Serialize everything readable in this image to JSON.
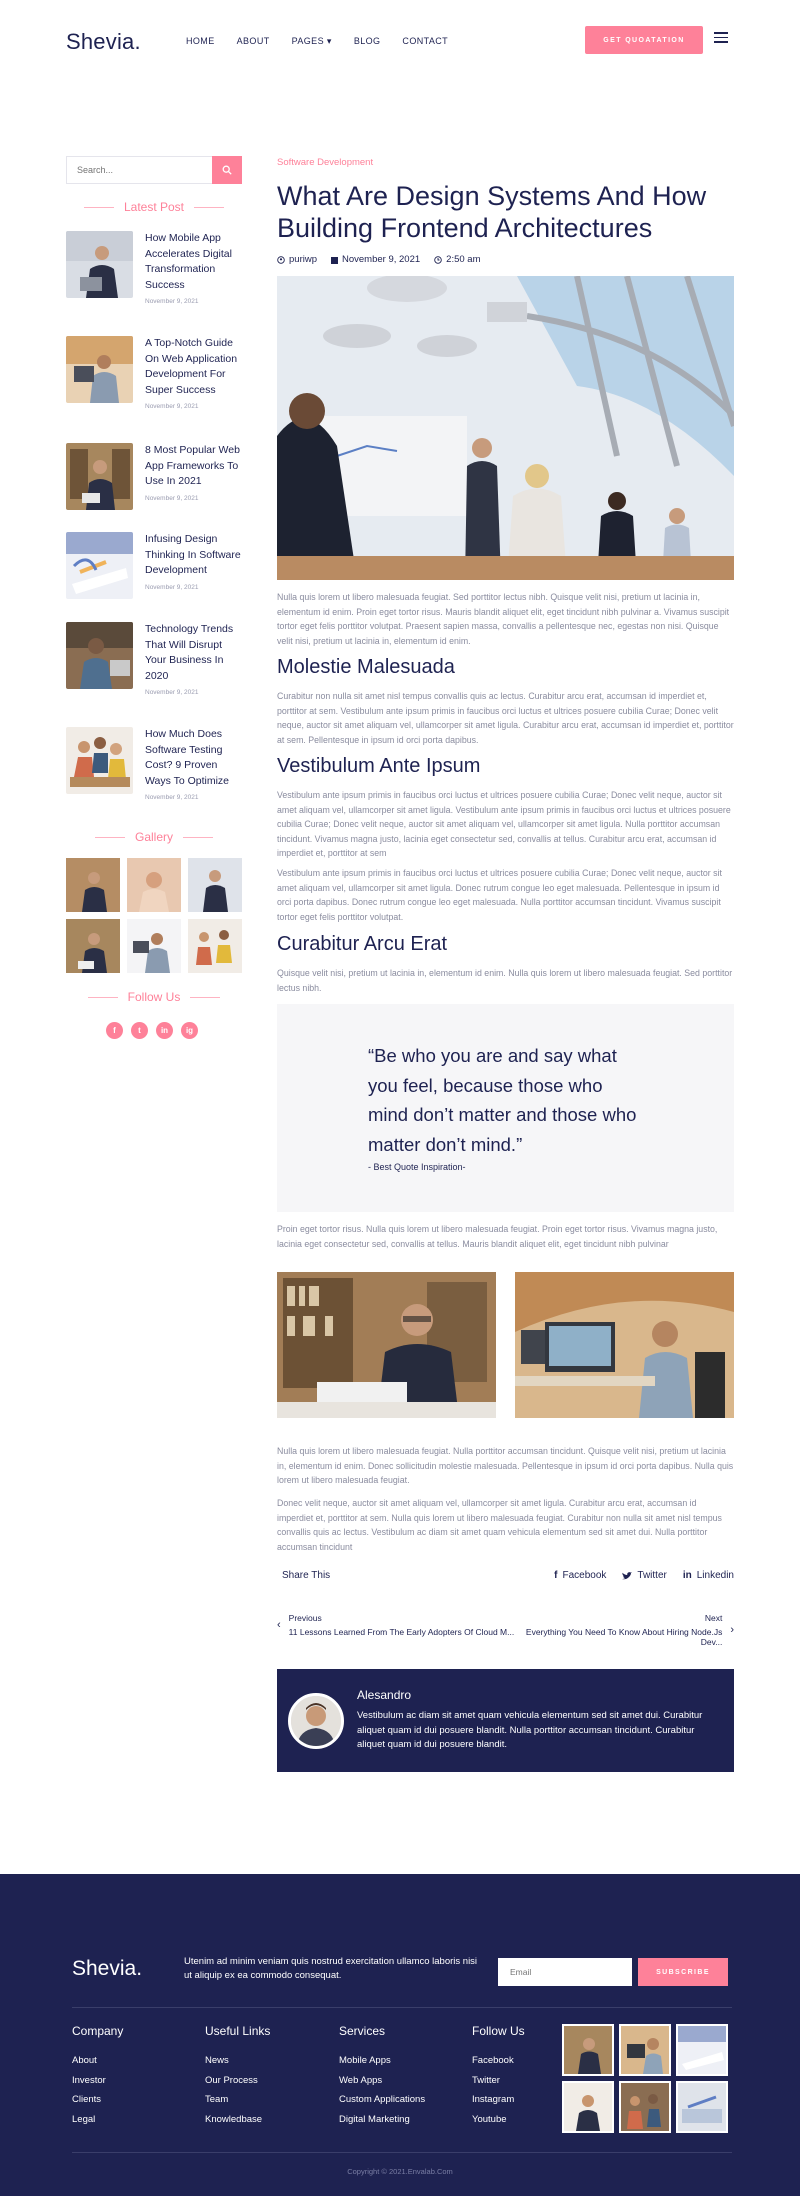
{
  "header": {
    "logo": "Shevia.",
    "nav": [
      "HOME",
      "ABOUT",
      "PAGES",
      "BLOG",
      "CONTACT"
    ],
    "quote_button": "GET QUOATATION"
  },
  "sidebar": {
    "search_placeholder": "Search...",
    "latest_title": "Latest Post",
    "posts": [
      {
        "title": "How Mobile App Accelerates Digital Transformation Success",
        "date": "November 9, 2021"
      },
      {
        "title": "A Top-Notch Guide On Web Application Development For Super Success",
        "date": "November 9, 2021"
      },
      {
        "title": "8 Most Popular Web App Frameworks To Use In 2021",
        "date": "November 9, 2021"
      },
      {
        "title": "Infusing Design Thinking In Software Development",
        "date": "November 9, 2021"
      },
      {
        "title": "Technology Trends That Will Disrupt Your Business In 2020",
        "date": "November 9, 2021"
      },
      {
        "title": "How Much Does Software Testing Cost? 9 Proven Ways To Optimize",
        "date": "November 9, 2021"
      }
    ],
    "gallery_title": "Gallery",
    "follow_title": "Follow Us",
    "socials": [
      "f",
      "t",
      "in",
      "ig"
    ]
  },
  "article": {
    "category": "Software Development",
    "title": "What Are Design Systems And How Building Frontend Architectures",
    "author": "puriwp",
    "date": "November 9, 2021",
    "read_time": "2:50 am",
    "p1": "Nulla quis lorem ut libero malesuada feugiat. Sed porttitor lectus nibh. Quisque velit nisi, pretium ut lacinia in, elementum id enim. Proin eget tortor risus. Mauris blandit aliquet elit, eget tincidunt nibh pulvinar a. Vivamus suscipit tortor eget felis porttitor volutpat. Praesent sapien massa, convallis a pellentesque nec, egestas non nisi. Quisque velit nisi, pretium ut lacinia in, elementum id enim.",
    "h_molestie": "Molestie Malesuada",
    "p2": "Curabitur non nulla sit amet nisl tempus convallis quis ac lectus. Curabitur arcu erat, accumsan id imperdiet et, porttitor at sem. Vestibulum ante ipsum primis in faucibus orci luctus et ultrices posuere cubilia Curae; Donec velit neque, auctor sit amet aliquam vel, ullamcorper sit amet ligula. Curabitur arcu erat, accumsan id imperdiet et, porttitor at sem. Pellentesque in ipsum id orci porta dapibus.",
    "h_vestibulum": "Vestibulum Ante Ipsum",
    "p3": "Vestibulum ante ipsum primis in faucibus orci luctus et ultrices posuere cubilia Curae; Donec velit neque, auctor sit amet aliquam vel, ullamcorper sit amet ligula. Vestibulum ante ipsum primis in faucibus orci luctus et ultrices posuere cubilia Curae; Donec velit neque, auctor sit amet aliquam vel, ullamcorper sit amet ligula. Nulla porttitor accumsan tincidunt. Vivamus magna justo, lacinia eget consectetur sed, convallis at tellus. Curabitur arcu erat, accumsan id imperdiet et, porttitor at sem",
    "p4": "Vestibulum ante ipsum primis in faucibus orci luctus et ultrices posuere cubilia Curae; Donec velit neque, auctor sit amet aliquam vel, ullamcorper sit amet ligula. Donec rutrum congue leo eget malesuada. Pellentesque in ipsum id orci porta dapibus. Donec rutrum congue leo eget malesuada. Nulla porttitor accumsan tincidunt. Vivamus suscipit tortor eget felis porttitor volutpat.",
    "h_curabitur": "Curabitur Arcu Erat",
    "p5": "Quisque velit nisi, pretium ut lacinia in, elementum id enim. Nulla quis lorem ut libero malesuada feugiat. Sed porttitor lectus nibh.",
    "quote": "“Be who you are and say what you feel, because those who mind don’t matter and those who matter don’t mind.”",
    "quote_cite": "- Best Quote Inspiration-",
    "p6": "Proin eget tortor risus. Nulla quis lorem ut libero malesuada feugiat. Proin eget tortor risus. Vivamus magna justo, lacinia eget consectetur sed, convallis at tellus. Mauris blandit aliquet elit, eget tincidunt nibh pulvinar",
    "p7": "Nulla quis lorem ut libero malesuada feugiat. Nulla porttitor accumsan tincidunt. Quisque velit nisi, pretium ut lacinia in, elementum id enim. Donec sollicitudin molestie malesuada. Pellentesque in ipsum id orci porta dapibus. Nulla quis lorem ut libero malesuada feugiat.",
    "p8": "Donec velit neque, auctor sit amet aliquam vel, ullamcorper sit amet ligula. Curabitur arcu erat, accumsan id imperdiet et, porttitor at sem. Nulla quis lorem ut libero malesuada feugiat. Curabitur non nulla sit amet nisl tempus convallis quis ac lectus. Vestibulum ac diam sit amet quam vehicula elementum sed sit amet dui. Nulla porttitor accumsan tincidunt",
    "share_label": "Share This",
    "share": [
      "Facebook",
      "Twitter",
      "Linkedin"
    ],
    "prev_label": "Previous",
    "prev_title": "11 Lessons Learned From The Early Adopters Of Cloud M...",
    "next_label": "Next",
    "next_title": "Everything You Need To Know About Hiring Node.Js Dev...",
    "author_name": "Alesandro",
    "author_bio": "Vestibulum ac diam sit amet quam vehicula elementum sed sit amet dui. Curabitur aliquet quam id dui posuere blandit. Nulla porttitor accumsan tincidunt. Curabitur aliquet quam id dui posuere blandit."
  },
  "footer": {
    "logo": "Shevia.",
    "tagline": "Utenim ad minim veniam quis nostrud exercitation ullamco laboris nisi ut aliquip ex ea commodo consequat.",
    "email_placeholder": "Email",
    "subscribe": "SUBSCRIBE",
    "columns": [
      {
        "title": "Company",
        "items": [
          "About",
          "Investor",
          "Clients",
          "Legal"
        ]
      },
      {
        "title": "Useful Links",
        "items": [
          "News",
          "Our Process",
          "Team",
          "Knowledbase"
        ]
      },
      {
        "title": "Services",
        "items": [
          "Mobile Apps",
          "Web Apps",
          "Custom Applications",
          "Digital Marketing"
        ]
      },
      {
        "title": "Follow Us",
        "items": [
          "Facebook",
          "Twitter",
          "Instagram",
          "Youtube"
        ]
      }
    ],
    "copyright": "Copyright © 2021.Envalab.Com"
  },
  "colors": {
    "navy": "#1e2251",
    "accent": "#fe8199",
    "muted": "#8a8c9f"
  }
}
